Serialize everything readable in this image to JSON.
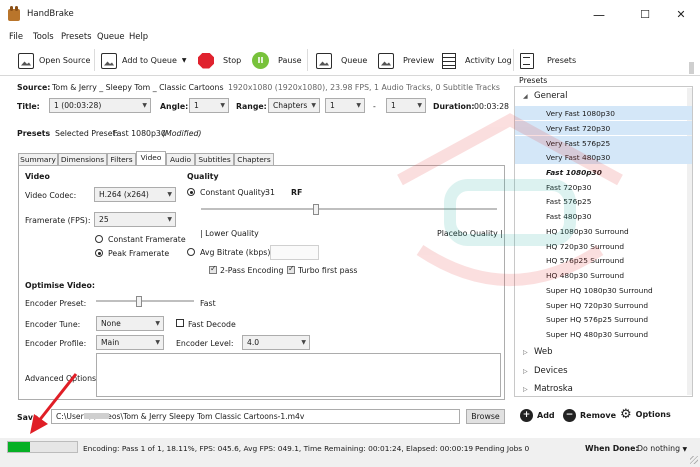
{
  "window": {
    "title": "HandBrake",
    "minimize": "—",
    "maximize": "☐",
    "close": "✕"
  },
  "menu": [
    "File",
    "Tools",
    "Presets",
    "Queue",
    "Help"
  ],
  "toolbar": {
    "open_source": "Open Source",
    "add_to_queue": "Add to Queue",
    "stop": "Stop",
    "pause": "Pause",
    "queue": "Queue",
    "preview": "Preview",
    "activity_log": "Activity Log",
    "presets": "Presets"
  },
  "source": {
    "label": "Source:",
    "name": "Tom & Jerry _ Sleepy Tom _ Classic Cartoons",
    "info": "1920x1080 (1920x1080), 23.98 FPS, 1 Audio Tracks, 0 Subtitle Tracks"
  },
  "title_row": {
    "title_label": "Title:",
    "title_value": "1 (00:03:28)",
    "angle_label": "Angle:",
    "angle_value": "1",
    "range_label": "Range:",
    "range_type": "Chapters",
    "range_start": "1",
    "range_dash": "-",
    "range_end": "1",
    "duration_label": "Duration:",
    "duration_value": "00:03:28"
  },
  "presets_row": {
    "label": "Presets",
    "selected_label": "Selected Preset:",
    "selected_value": "Fast 1080p30",
    "modified": "(Modified)"
  },
  "tabs": [
    "Summary",
    "Dimensions",
    "Filters",
    "Video",
    "Audio",
    "Subtitles",
    "Chapters"
  ],
  "video": {
    "section": "Video",
    "codec_label": "Video Codec:",
    "codec_value": "H.264 (x264)",
    "framerate_label": "Framerate (FPS):",
    "framerate_value": "25",
    "constant_framerate": "Constant Framerate",
    "peak_framerate": "Peak Framerate"
  },
  "quality": {
    "section": "Quality",
    "constant_quality": "Constant Quality:",
    "quality_value": "31",
    "rf": "RF",
    "lower": "| Lower Quality",
    "placebo": "Placebo Quality |",
    "avg_bitrate": "Avg Bitrate (kbps):",
    "two_pass": "2-Pass Encoding",
    "turbo": "Turbo first pass"
  },
  "optimise": {
    "section": "Optimise Video:",
    "preset_label": "Encoder Preset:",
    "preset_value": "Fast",
    "tune_label": "Encoder Tune:",
    "tune_value": "None",
    "fast_decode": "Fast Decode",
    "profile_label": "Encoder Profile:",
    "profile_value": "Main",
    "level_label": "Encoder Level:",
    "level_value": "4.0",
    "advanced_label": "Advanced Options:"
  },
  "save": {
    "label": "Save",
    "path": "C:\\Users\\          \\Videos\\Tom & Jerry  Sleepy Tom  Classic Cartoons-1.m4v",
    "browse": "Browse"
  },
  "presets_panel": {
    "header": "Presets",
    "general": "General",
    "items": [
      "Very Fast 1080p30",
      "Very Fast 720p30",
      "Very Fast 576p25",
      "Very Fast 480p30",
      "Fast 1080p30",
      "Fast 720p30",
      "Fast 576p25",
      "Fast 480p30",
      "HQ 1080p30 Surround",
      "HQ 720p30 Surround",
      "HQ 576p25 Surround",
      "HQ 480p30 Surround",
      "Super HQ 1080p30 Surround",
      "Super HQ 720p30 Surround",
      "Super HQ 576p25 Surround",
      "Super HQ 480p30 Surround"
    ],
    "groups": [
      "Web",
      "Devices",
      "Matroska"
    ],
    "add": "Add",
    "remove": "Remove",
    "options": "Options"
  },
  "status": {
    "progress": 0.32,
    "encoding": "Encoding: Pass 1 of 1,  18.11%, FPS: 045.6,  Avg FPS: 049.1,  Time Remaining: 00:01:24,  Elapsed: 00:00:19",
    "pending": "Pending Jobs 0",
    "when_done_label": "When Done:",
    "when_done_value": "Do nothing"
  },
  "colors": {
    "progress": "#06b025",
    "stop": "#e0222e",
    "pause": "#78c23b",
    "preset_highlight": "#d4e7f8",
    "watermark": "#e63b3b",
    "watermark_teal": "#2bb3a6"
  }
}
